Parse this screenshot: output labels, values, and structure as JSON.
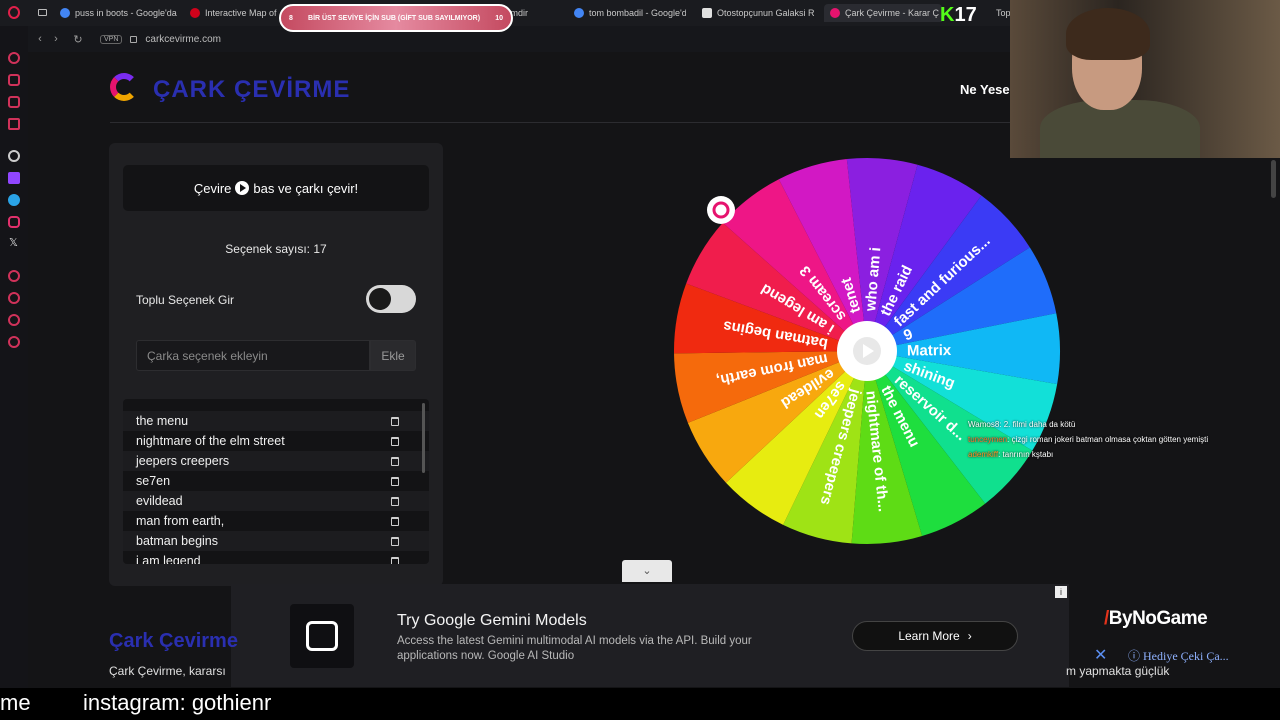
{
  "browser": {
    "tabs": [
      {
        "label": "puss in boots - Google'da",
        "color": "#4285f4"
      },
      {
        "label": "Interactive Map of",
        "color": "#d0021b"
      },
      {
        "label": "golfin kimdir",
        "color": "#4285f4"
      },
      {
        "label": "tom bombadil - Google'da",
        "color": "#4285f4"
      },
      {
        "label": "Otostopçunun Galaksi Re",
        "color": "#e0e0e0"
      },
      {
        "label": "Çark Çevirme - Karar Ç",
        "color": "#e6136e"
      },
      {
        "label": "Top",
        "color": "#888888"
      }
    ],
    "url": "carkcevirme.com",
    "vpn_label": "VPN"
  },
  "site": {
    "brand_title": "ÇARK ÇEVİRME",
    "nav_link": "Ne Yesem"
  },
  "panel": {
    "spin_text_before": "Çevire",
    "spin_text_after": "bas ve çarkı çevir!",
    "count_label": "Seçenek sayısı: 17",
    "bulk_label": "Toplu Seçenek Gir",
    "input_placeholder": "Çarka seçenek ekleyin",
    "add_label": "Ekle",
    "options": [
      "the menu",
      "nightmare of the elm street",
      "jeepers creepers",
      "se7en",
      "evildead",
      "man from earth,",
      "batman begins",
      "i am legend"
    ]
  },
  "wheel": {
    "segments": [
      {
        "label": "who am i",
        "color": "#8b1fe0"
      },
      {
        "label": "the raid",
        "color": "#6a22ee"
      },
      {
        "label": "fast and furious...",
        "color": "#3b3bf5"
      },
      {
        "label": "9",
        "color": "#1f6dfa"
      },
      {
        "label": "Matrix",
        "color": "#10b8f5"
      },
      {
        "label": "shining",
        "color": "#12e0d8"
      },
      {
        "label": "reservoir d...",
        "color": "#10e08e"
      },
      {
        "label": "the menu",
        "color": "#1ede3e"
      },
      {
        "label": "nightmare of th...",
        "color": "#5edc15"
      },
      {
        "label": "jeepers creepers",
        "color": "#9fe315"
      },
      {
        "label": "se7en",
        "color": "#e7ec10"
      },
      {
        "label": "evildead",
        "color": "#f8a80e"
      },
      {
        "label": "man from earth,",
        "color": "#f56a0c"
      },
      {
        "label": "batman begins",
        "color": "#f02a10"
      },
      {
        "label": "i am legend",
        "color": "#f01d4c"
      },
      {
        "label": "scream 3",
        "color": "#ee1686"
      },
      {
        "label": "tenet",
        "color": "#d218c4"
      }
    ]
  },
  "stream": {
    "banner_left": "8",
    "banner_text": "BİR ÜST SEVİYE İÇİN SUB (GİFT SUB SAYILMIYOR)",
    "banner_right": "10",
    "k17_k": "K",
    "k17_num": "17",
    "chat": [
      {
        "user": "Wamos8",
        "text": ": 2. filmi daha da kötü"
      },
      {
        "user": "tunceymen",
        "text": ": çizgi roman jokeri batman olmasa çoktan götten yemişti"
      },
      {
        "user": "ademkiff",
        "text": ": tanrının kştabı"
      }
    ],
    "overlay_left": "me",
    "overlay_ig": "instagram: gothienr"
  },
  "ad": {
    "title": "Try Google Gemini Models",
    "desc": "Access the latest Gemini multimodal AI models via the API. Build your applications now. Google AI Studio",
    "cta": "Learn More",
    "info": "i"
  },
  "section": {
    "title": "Çark Çevirme",
    "text": "Çark Çevirme, kararsı",
    "text_right": "m yapmakta güçlük"
  },
  "bynogame": {
    "brand": "ByNoGame",
    "gift_link": "Hediye Çeki Ça..."
  }
}
